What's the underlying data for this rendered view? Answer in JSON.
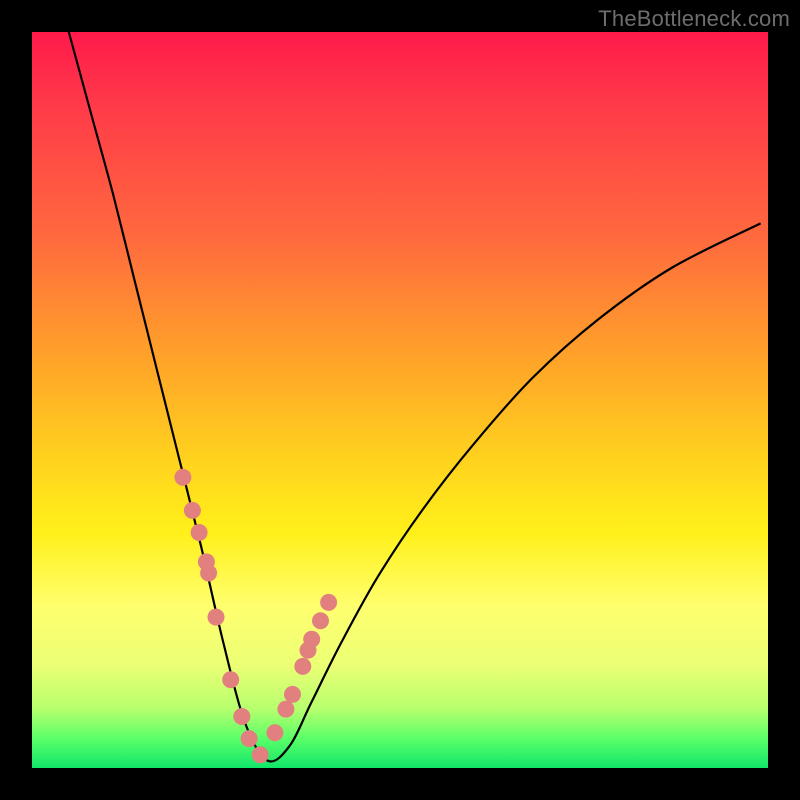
{
  "watermark": "TheBottleneck.com",
  "chart_data": {
    "type": "line",
    "title": "",
    "xlabel": "",
    "ylabel": "",
    "xlim": [
      0,
      100
    ],
    "ylim": [
      0,
      100
    ],
    "grid": false,
    "legend": false,
    "description": "Bottleneck percentage curve on a red-to-green gradient. The black curve descends steeply from upper-left, reaches near-zero around x≈28–34, then rises toward the right. Salmon markers highlight sampled data points clustered near the trough and on both flanks.",
    "series": [
      {
        "name": "bottleneck-curve",
        "x": [
          5,
          8,
          11,
          14,
          17,
          20,
          23,
          26,
          29,
          32,
          35,
          38,
          42,
          47,
          53,
          60,
          68,
          77,
          87,
          99
        ],
        "y": [
          100,
          89,
          78,
          66,
          54,
          42,
          30,
          17,
          6,
          1,
          3,
          9,
          17,
          26,
          35,
          44,
          53,
          61,
          68,
          74
        ]
      }
    ],
    "markers": {
      "name": "sample-points",
      "x": [
        20.5,
        21.8,
        22.7,
        23.7,
        24.0,
        25.0,
        27.0,
        28.5,
        29.5,
        31.0,
        33.0,
        34.5,
        35.4,
        36.8,
        37.5,
        38.0,
        39.2,
        40.3
      ],
      "y": [
        39.5,
        35.0,
        32.0,
        28.0,
        26.5,
        20.5,
        12.0,
        7.0,
        4.0,
        1.8,
        4.8,
        8.0,
        10.0,
        13.8,
        16.0,
        17.5,
        20.0,
        22.5
      ]
    },
    "gradient_colors": {
      "top": "#ff1a4b",
      "mid_upper": "#ffa528",
      "mid": "#ffff6e",
      "bottom": "#11e66a"
    }
  }
}
